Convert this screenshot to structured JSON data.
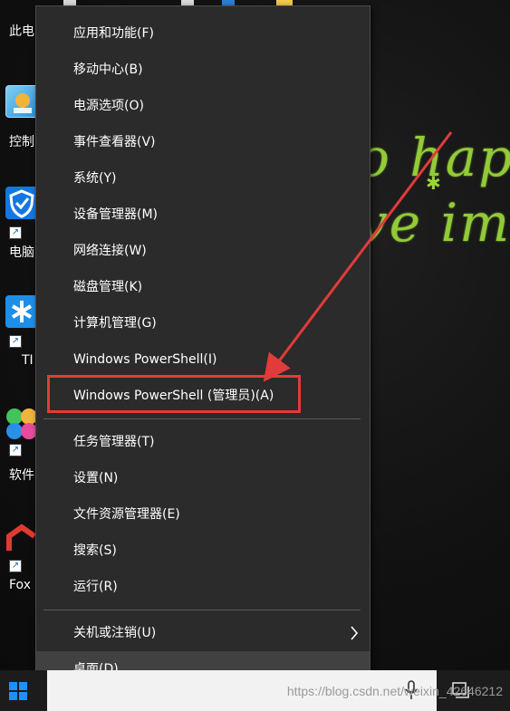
{
  "desktop": {
    "wallpaper_line1": "o happy",
    "wallpaper_line2": "ve imag",
    "icons": [
      {
        "label": "此电",
        "icon": "this-pc-icon"
      },
      {
        "label": "控制",
        "icon": "control-panel-icon"
      },
      {
        "label": "电脑",
        "icon": "security-shield-icon"
      },
      {
        "label": "TI",
        "icon": "app-icon"
      },
      {
        "label": "软件",
        "icon": "software-store-icon"
      },
      {
        "label": "Fox",
        "icon": "foxit-icon"
      }
    ]
  },
  "menu": {
    "group1": [
      {
        "label": "应用和功能(F)"
      },
      {
        "label": "移动中心(B)"
      },
      {
        "label": "电源选项(O)"
      },
      {
        "label": "事件查看器(V)"
      },
      {
        "label": "系统(Y)"
      },
      {
        "label": "设备管理器(M)"
      },
      {
        "label": "网络连接(W)"
      },
      {
        "label": "磁盘管理(K)"
      },
      {
        "label": "计算机管理(G)"
      },
      {
        "label": "Windows PowerShell(I)"
      },
      {
        "label": "Windows PowerShell (管理员)(A)"
      }
    ],
    "group2": [
      {
        "label": "任务管理器(T)"
      },
      {
        "label": "设置(N)"
      },
      {
        "label": "文件资源管理器(E)"
      },
      {
        "label": "搜索(S)"
      },
      {
        "label": "运行(R)"
      }
    ],
    "group3": [
      {
        "label": "关机或注销(U)",
        "has_submenu": true
      },
      {
        "label": "桌面(D)"
      }
    ]
  },
  "annotation": {
    "color": "#e23b3b",
    "highlighted_item": "Windows PowerShell (管理员)(A)"
  },
  "taskbar": {
    "watermark": "https://blog.csdn.net/weixin_42646212"
  },
  "colors": {
    "menu_bg": "#2b2b2b",
    "menu_hover": "#414141",
    "wallpaper_accent": "#9ad43a",
    "start_blue": "#1e90ff"
  }
}
